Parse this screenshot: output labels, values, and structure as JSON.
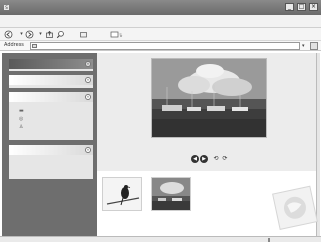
{
  "titlebar": {
    "app_icon": "S",
    "window_buttons": [
      "_",
      "□",
      "×"
    ]
  },
  "toolbar": {
    "back_icon": "back-arrow-icon",
    "forward_icon": "forward-arrow-icon",
    "up_icon": "up-folder-icon",
    "search_icon": "search-icon",
    "folders_icon": "folders-icon",
    "views_icon": "views-icon"
  },
  "address": {
    "label": "Address",
    "value": ""
  },
  "taskpane": {
    "panels": [
      {
        "title": "",
        "tasks": []
      },
      {
        "title": "",
        "tasks": []
      },
      {
        "title": "",
        "tasks": [
          "",
          "",
          ""
        ]
      },
      {
        "title": "",
        "tasks": []
      }
    ]
  },
  "viewer": {
    "tools": [
      "◀",
      "▶",
      "⟲",
      "⟳"
    ]
  },
  "thumbnails": [
    {
      "name": "bird-on-branch"
    },
    {
      "name": "harbor-boats"
    }
  ],
  "colors": {
    "titlebar": "#7a7a7a",
    "taskpane": "#6e6e6e",
    "panel_header": "#ffffff"
  }
}
